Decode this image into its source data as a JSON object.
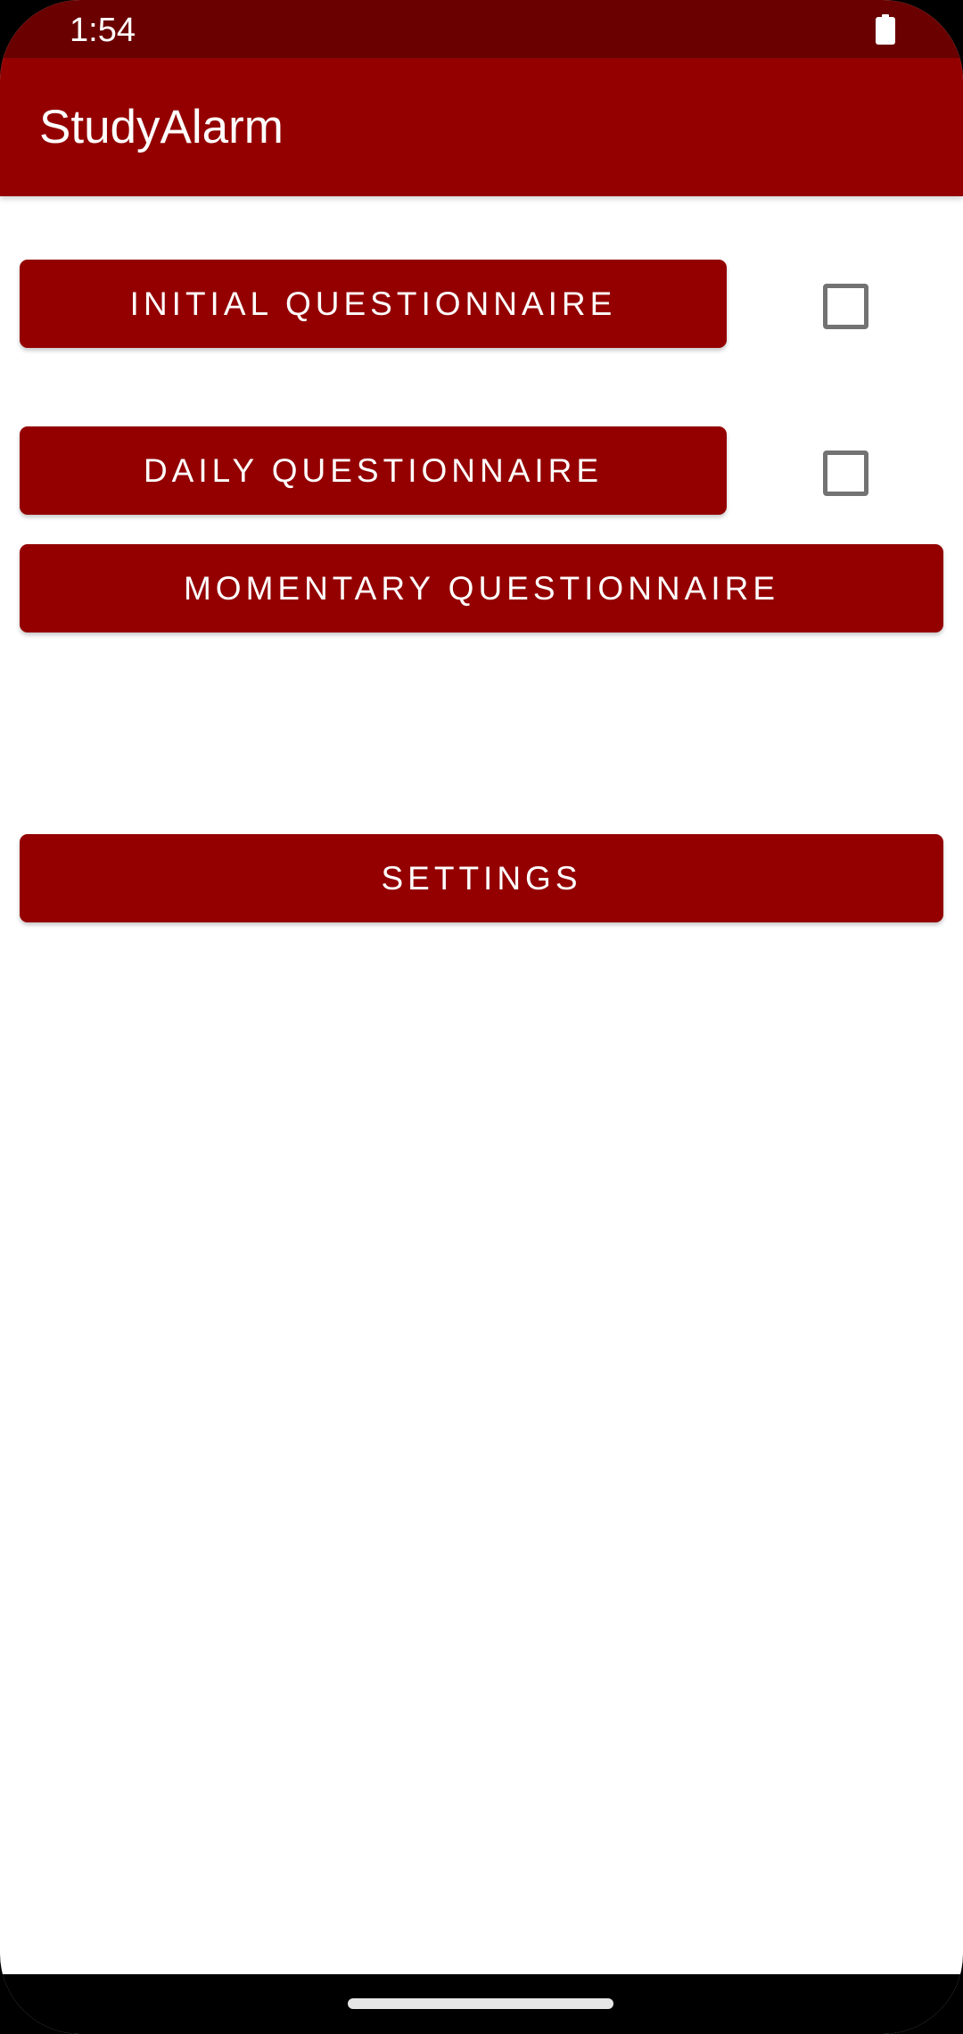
{
  "status_bar": {
    "time": "1:54",
    "battery_icon": "battery-full-icon"
  },
  "app_bar": {
    "title": "StudyAlarm"
  },
  "questionnaires": {
    "initial_label": "INITIAL QUESTIONNAIRE",
    "initial_completed": false,
    "daily_label": "DAILY QUESTIONNAIRE",
    "daily_completed": false,
    "momentary_label": "MOMENTARY QUESTIONNAIRE"
  },
  "settings": {
    "label": "SETTINGS"
  },
  "colors": {
    "status_bar": "#6a0000",
    "primary": "#940000",
    "checkbox_border": "#737373"
  }
}
